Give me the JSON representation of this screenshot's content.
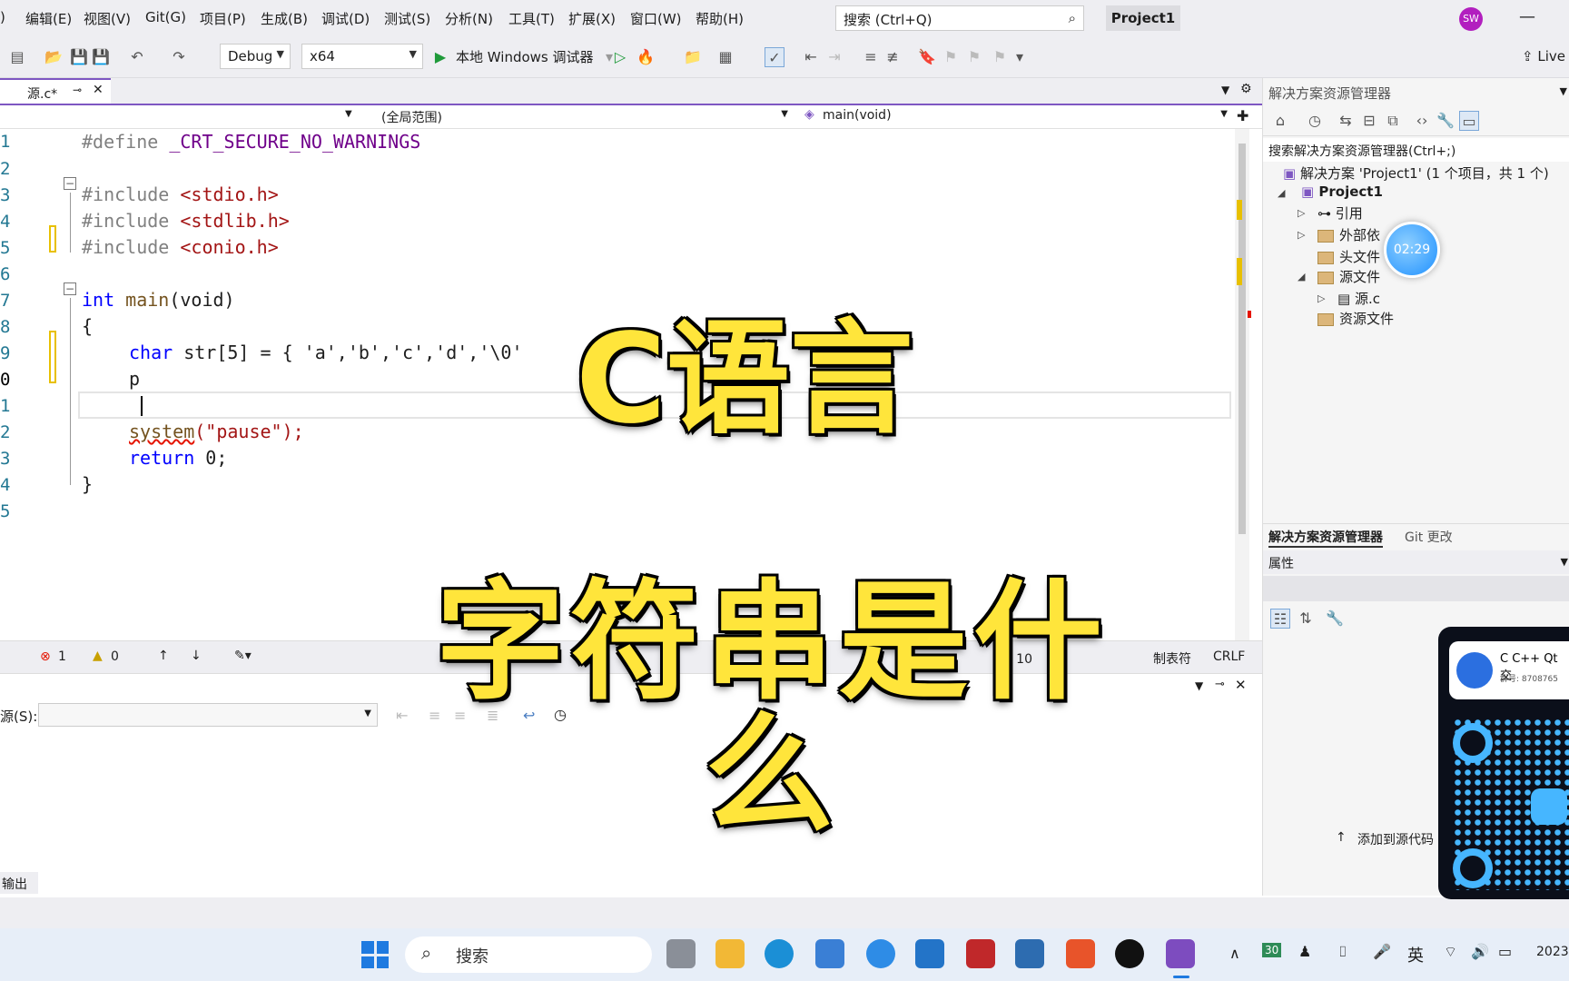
{
  "menubar": {
    "items": [
      "编辑(E)",
      "视图(V)",
      "Git(G)",
      "项目(P)",
      "生成(B)",
      "调试(D)",
      "测试(S)",
      "分析(N)",
      "工具(T)",
      "扩展(X)",
      "窗口(W)",
      "帮助(H)"
    ],
    "search_placeholder": "搜索 (Ctrl+Q)",
    "project": "Project1",
    "avatar": "SW",
    "minimize": "—"
  },
  "toolbar": {
    "config": "Debug",
    "platform": "x64",
    "debugger": "本地 Windows 调试器",
    "live_share": "Live"
  },
  "editor": {
    "tab": "源.c*",
    "scope": "(全局范围)",
    "function": "main(void)",
    "line_numbers": [
      "1",
      "2",
      "3",
      "4",
      "5",
      "6",
      "7",
      "8",
      "9",
      "0",
      "1",
      "2",
      "3",
      "4",
      "5"
    ],
    "lines": {
      "l1_pp": "#define",
      "l1_macro": " _CRT_SECURE_NO_WARNINGS",
      "l3_pp": "#include",
      "l3_hdr": " <stdio.h>",
      "l4_pp": "#include",
      "l4_hdr": " <stdlib.h>",
      "l5_pp": "#include",
      "l5_hdr": " <conio.h>",
      "l7_kw": "int",
      "l7_fn": " main",
      "l7_rest": "(void)",
      "l8": "{",
      "l9_kw": "char",
      "l9_rest": " str[5] = { 'a','b','c','d','\\0'",
      "l10": "p",
      "l12_fn": "system",
      "l12_str": "(\"pause\");",
      "l13_kw": "return",
      "l13_rest": " 0;",
      "l14": "}"
    }
  },
  "status_strip": {
    "errors": "1",
    "warnings": "0",
    "col": "字: 10",
    "tabs": "制表符",
    "eol": "CRLF"
  },
  "output": {
    "source_label": "源(S):",
    "tab": "输出"
  },
  "solution": {
    "title": "解决方案资源管理器",
    "search": "搜索解决方案资源管理器(Ctrl+;)",
    "solution_node": "解决方案 'Project1' (1 个项目，共 1 个)",
    "project_node": "Project1",
    "nodes": [
      "引用",
      "外部依",
      "头文件",
      "源文件",
      "源.c",
      "资源文件"
    ],
    "bottom_tabs": [
      "解决方案资源管理器",
      "Git 更改"
    ],
    "properties": "属性",
    "add_source": "添加到源代码"
  },
  "timer": "02:29",
  "captions": {
    "title": "C语言",
    "subtitle": "字符串是什么"
  },
  "qr_card": {
    "group": "C C++ Qt交",
    "group_no": "群号: 8708765"
  },
  "taskbar": {
    "search": "搜索",
    "lang": "英",
    "badge": "30",
    "date": "2023-"
  }
}
